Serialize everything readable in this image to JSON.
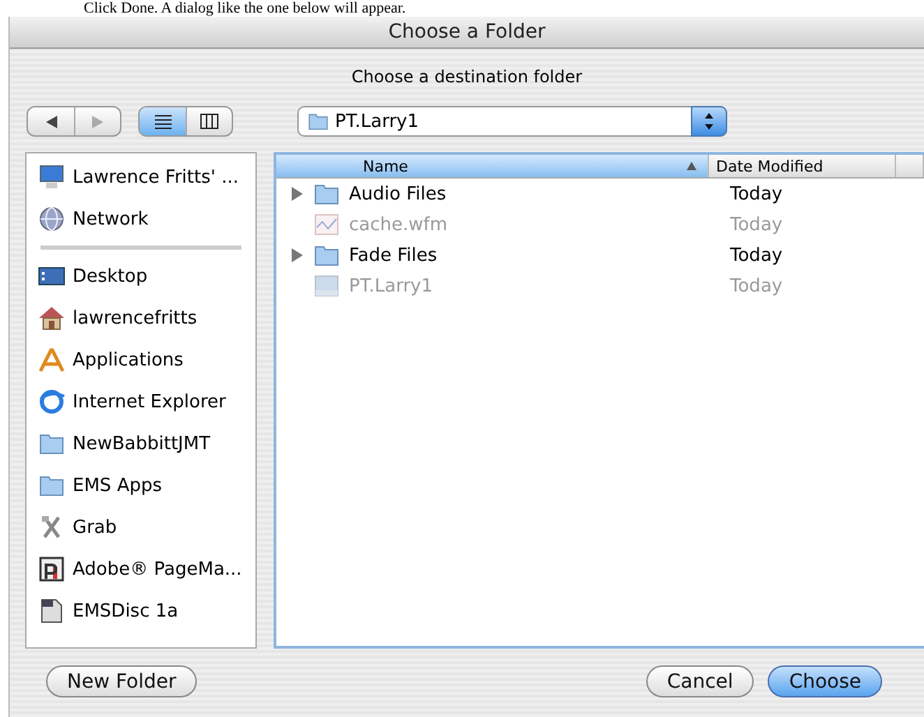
{
  "page_text": "Click Done. A dialog like the one below will appear.",
  "window": {
    "title": "Choose a Folder"
  },
  "prompt": "Choose a destination folder",
  "toolbar": {
    "back_disabled": false,
    "forward_disabled": true,
    "view_modes": [
      {
        "kind": "list",
        "selected": true
      },
      {
        "kind": "columns",
        "selected": false
      }
    ],
    "location": "PT.Larry1"
  },
  "sidebar": {
    "devices": [
      {
        "label": "Lawrence Fritts' ...",
        "kind": "computer"
      },
      {
        "label": "Network",
        "kind": "network"
      }
    ],
    "places": [
      {
        "label": "Desktop",
        "kind": "desktop"
      },
      {
        "label": "lawrencefritts",
        "kind": "home"
      },
      {
        "label": "Applications",
        "kind": "applications"
      },
      {
        "label": "Internet Explorer",
        "kind": "browser"
      },
      {
        "label": "NewBabbittJMT",
        "kind": "folder"
      },
      {
        "label": "EMS Apps",
        "kind": "folder"
      },
      {
        "label": "Grab",
        "kind": "app"
      },
      {
        "label": "Adobe® PageMa...",
        "kind": "pagemaker"
      },
      {
        "label": "EMSDisc 1a",
        "kind": "document"
      }
    ]
  },
  "file_list": {
    "columns": [
      {
        "label": "Name",
        "sorted": true
      },
      {
        "label": "Date Modified",
        "sorted": false
      }
    ],
    "rows": [
      {
        "name": "Audio Files",
        "date": "Today",
        "kind": "folder",
        "disabled": false
      },
      {
        "name": "cache.wfm",
        "date": "Today",
        "kind": "file",
        "disabled": true
      },
      {
        "name": "Fade Files",
        "date": "Today",
        "kind": "folder",
        "disabled": false
      },
      {
        "name": "PT.Larry1",
        "date": "Today",
        "kind": "project",
        "disabled": true
      }
    ]
  },
  "buttons": [
    {
      "label": "New Folder",
      "default": false
    },
    {
      "label": "Cancel",
      "default": false
    },
    {
      "label": "Choose",
      "default": true
    }
  ]
}
